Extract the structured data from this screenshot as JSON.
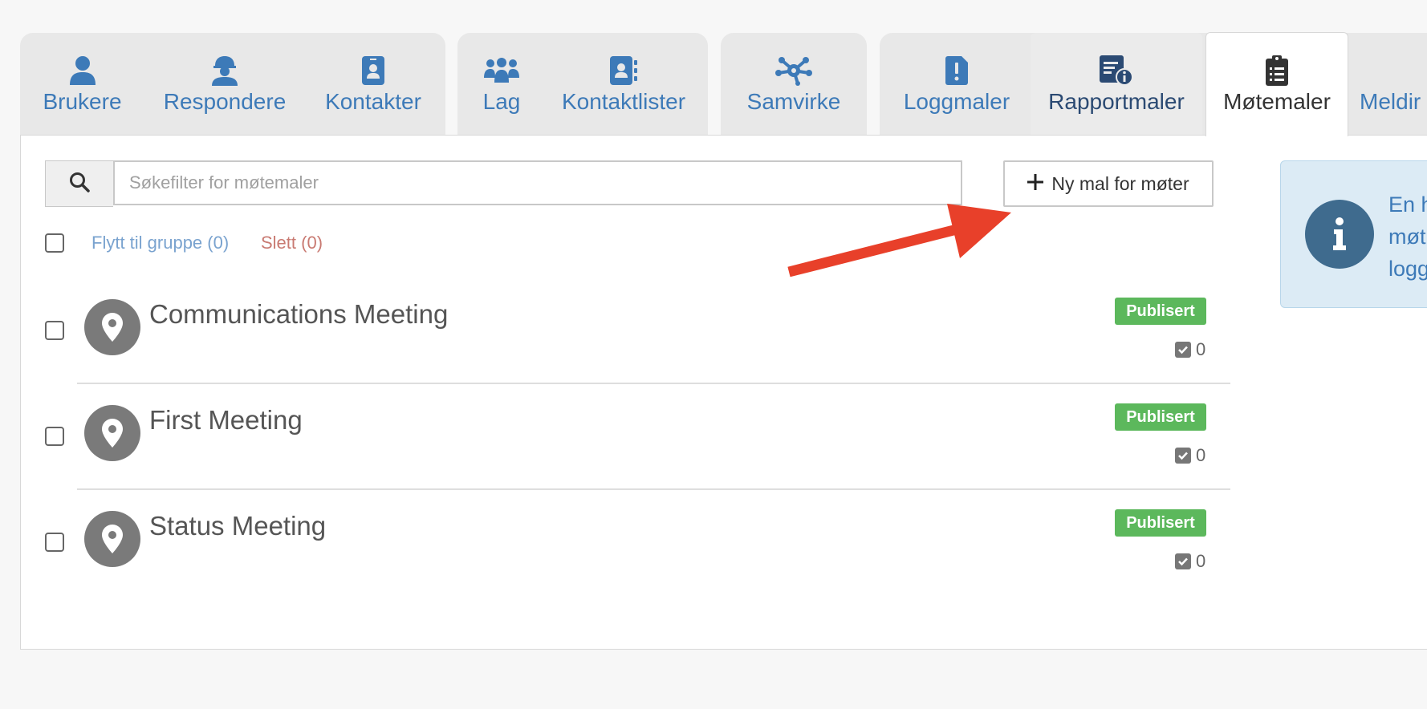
{
  "tabs": [
    {
      "label": "Brukere",
      "icon": "user-icon",
      "state": "normal"
    },
    {
      "label": "Respondere",
      "icon": "hardhat-worker-icon",
      "state": "normal"
    },
    {
      "label": "Kontakter",
      "icon": "contact-card-icon",
      "state": "normal"
    },
    {
      "label": "Lag",
      "icon": "team-icon",
      "state": "normal"
    },
    {
      "label": "Kontaktlister",
      "icon": "address-book-icon",
      "state": "normal"
    },
    {
      "label": "Samvirke",
      "icon": "network-hub-icon",
      "state": "normal"
    },
    {
      "label": "Loggmaler",
      "icon": "file-exclamation-icon",
      "state": "normal"
    },
    {
      "label": "Rapportmaler",
      "icon": "report-info-icon",
      "state": "hover"
    },
    {
      "label": "Møtemaler",
      "icon": "clipboard-list-icon",
      "state": "active"
    },
    {
      "label": "Meldir",
      "icon": "",
      "state": "normal"
    }
  ],
  "search": {
    "placeholder": "Søkefilter for møtemaler",
    "value": ""
  },
  "new_button": {
    "label": "Ny mal for møter",
    "icon": "plus-icon"
  },
  "bulk": {
    "move_label": "Flytt til gruppe (0)",
    "delete_label": "Slett (0)"
  },
  "items": [
    {
      "title": "Communications Meeting",
      "status": "Publisert",
      "count": "0"
    },
    {
      "title": "First Meeting",
      "status": "Publisert",
      "count": "0"
    },
    {
      "title": "Status Meeting",
      "status": "Publisert",
      "count": "0"
    }
  ],
  "info": {
    "lines": [
      "En h",
      "møt",
      "logg"
    ]
  },
  "colors": {
    "link": "#3d7ab8",
    "badge": "#5cb85c",
    "arrow": "#e8402a",
    "info_bg": "#dcebf5"
  }
}
